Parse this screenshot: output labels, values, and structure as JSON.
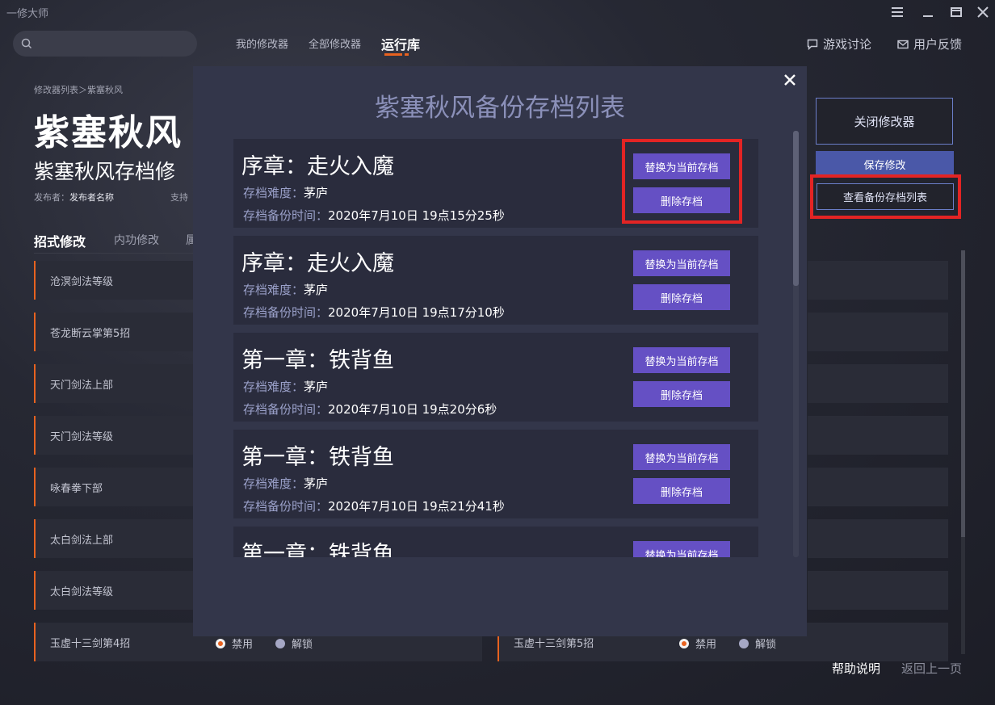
{
  "app": {
    "title": "一修大师"
  },
  "search": {
    "placeholder": ""
  },
  "nav": {
    "tabs": [
      {
        "label": "我的修改器"
      },
      {
        "label": "全部修改器"
      },
      {
        "label": "运行库"
      }
    ],
    "discussion": "游戏讨论",
    "feedback": "用户反馈"
  },
  "game": {
    "breadcrumb": "修改器列表＞紫塞秋风",
    "title": "紫塞秋风",
    "subtitle": "紫塞秋风存档修",
    "publisher_label": "发布者：",
    "publisher_name": "发布者名称",
    "support_label": "支持"
  },
  "subtabs": [
    {
      "label": "招式修改"
    },
    {
      "label": "内功修改"
    },
    {
      "label": "属"
    }
  ],
  "cheats_left": [
    "沧溟剑法等级",
    "苍龙断云掌第5招",
    "天门剑法上部",
    "天门剑法等级",
    "咏春拳下部",
    "太白剑法上部",
    "太白剑法等级",
    "玉虚十三剑第4招"
  ],
  "cheats_right_visible": "玉虚十三剑第5招",
  "radio": {
    "disable": "禁用",
    "unlock": "解锁"
  },
  "right_panel": {
    "close_trainer": "关闭修改器",
    "save": "保存修改",
    "view_backups": "查看备份存档列表"
  },
  "footer": {
    "help": "帮助说明",
    "back": "返回上一页"
  },
  "modal": {
    "title": "紫塞秋风备份存档列表",
    "difficulty_label": "存档难度：",
    "time_label": "存档备份时间：",
    "replace_label": "替换为当前存档",
    "delete_label": "删除存档",
    "saves": [
      {
        "chapter": "序章：走火入魔",
        "difficulty": "茅庐",
        "time": "2020年7月10日 19点15分25秒"
      },
      {
        "chapter": "序章：走火入魔",
        "difficulty": "茅庐",
        "time": "2020年7月10日 19点17分10秒"
      },
      {
        "chapter": "第一章：铁背鱼",
        "difficulty": "茅庐",
        "time": "2020年7月10日 19点20分6秒"
      },
      {
        "chapter": "第一章：铁背鱼",
        "difficulty": "茅庐",
        "time": "2020年7月10日 19点21分41秒"
      },
      {
        "chapter": "第一章：铁背鱼"
      }
    ]
  },
  "colors": {
    "accent_orange": "#e8621f",
    "button_purple": "#6550c4",
    "highlight_red": "#e32424",
    "modal_bg": "#33364a"
  }
}
